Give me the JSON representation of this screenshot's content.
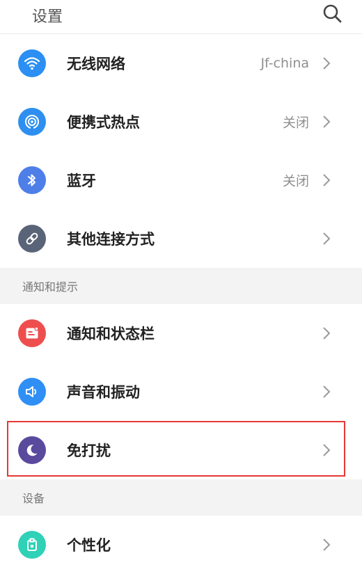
{
  "header": {
    "title": "设置",
    "search_icon": "search-icon"
  },
  "colors": {
    "wifi": "#2b8ff3",
    "hotspot": "#2e8ff0",
    "bluetooth": "#4e7fe8",
    "other": "#5a6478",
    "notification": "#ef4e4e",
    "sound": "#2f8ff5",
    "dnd": "#5a4a9e",
    "personalization": "#2fd1b7",
    "highlight": "#e53935"
  },
  "rows1": [
    {
      "label": "无线网络",
      "value": "Jf-china",
      "icon": "wifi-icon"
    },
    {
      "label": "便携式热点",
      "value": "关闭",
      "icon": "hotspot-icon"
    },
    {
      "label": "蓝牙",
      "value": "关闭",
      "icon": "bluetooth-icon"
    },
    {
      "label": "其他连接方式",
      "value": "",
      "icon": "link-icon"
    }
  ],
  "section1": {
    "label": "通知和提示"
  },
  "rows2": [
    {
      "label": "通知和状态栏",
      "value": "",
      "icon": "notification-icon"
    },
    {
      "label": "声音和振动",
      "value": "",
      "icon": "sound-icon"
    },
    {
      "label": "免打扰",
      "value": "",
      "icon": "moon-icon"
    }
  ],
  "section2": {
    "label": "设备"
  },
  "rows3": [
    {
      "label": "个性化",
      "value": "",
      "icon": "personalization-icon"
    }
  ]
}
